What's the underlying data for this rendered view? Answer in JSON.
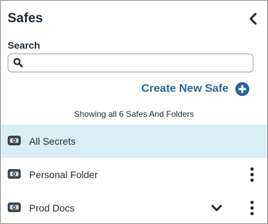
{
  "panel": {
    "title": "Safes",
    "collapse_icon": "chevron-left-icon"
  },
  "search": {
    "label": "Search",
    "value": "",
    "placeholder": "",
    "icon": "search-icon"
  },
  "create": {
    "label": "Create New Safe",
    "icon": "plus-circle-icon",
    "color": "#2e6496"
  },
  "summary": {
    "text": "Showing all 6 Safes And Folders"
  },
  "list": {
    "items": [
      {
        "label": "All Secrets",
        "icon": "safe-icon",
        "selected": true,
        "has_menu": false,
        "has_expand": false
      },
      {
        "label": "Personal Folder",
        "icon": "safe-icon",
        "selected": false,
        "has_menu": true,
        "has_expand": false
      },
      {
        "label": "Prod Docs",
        "icon": "safe-icon",
        "selected": false,
        "has_menu": true,
        "has_expand": true
      }
    ],
    "selected_bg": "#d9eef7"
  }
}
